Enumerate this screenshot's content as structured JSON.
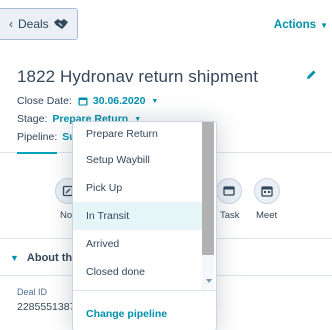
{
  "header": {
    "back_label": "Deals",
    "actions_label": "Actions"
  },
  "deal": {
    "title": "1822 Hydronav return shipment",
    "close_date_label": "Close Date:",
    "close_date_value": "30.06.2020",
    "stage_label": "Stage:",
    "stage_value": "Prepare Return",
    "pipeline_label": "Pipeline:",
    "pipeline_value": "Su"
  },
  "activities": {
    "note_label": "No",
    "task_label": "Task",
    "meet_label": "Meet"
  },
  "about": {
    "heading": "About th",
    "deal_id_label": "Deal ID",
    "deal_id_value": "2285551387"
  },
  "stage_dropdown": {
    "options": [
      "Prepare Return",
      "Setup Waybill",
      "Pick Up",
      "In Transit",
      "Arrived",
      "Closed done"
    ],
    "hovered": "In Transit",
    "footer_link": "Change pipeline"
  },
  "colors": {
    "accent": "#0091ae",
    "text": "#33475b",
    "hover": "#e5f5f8"
  }
}
